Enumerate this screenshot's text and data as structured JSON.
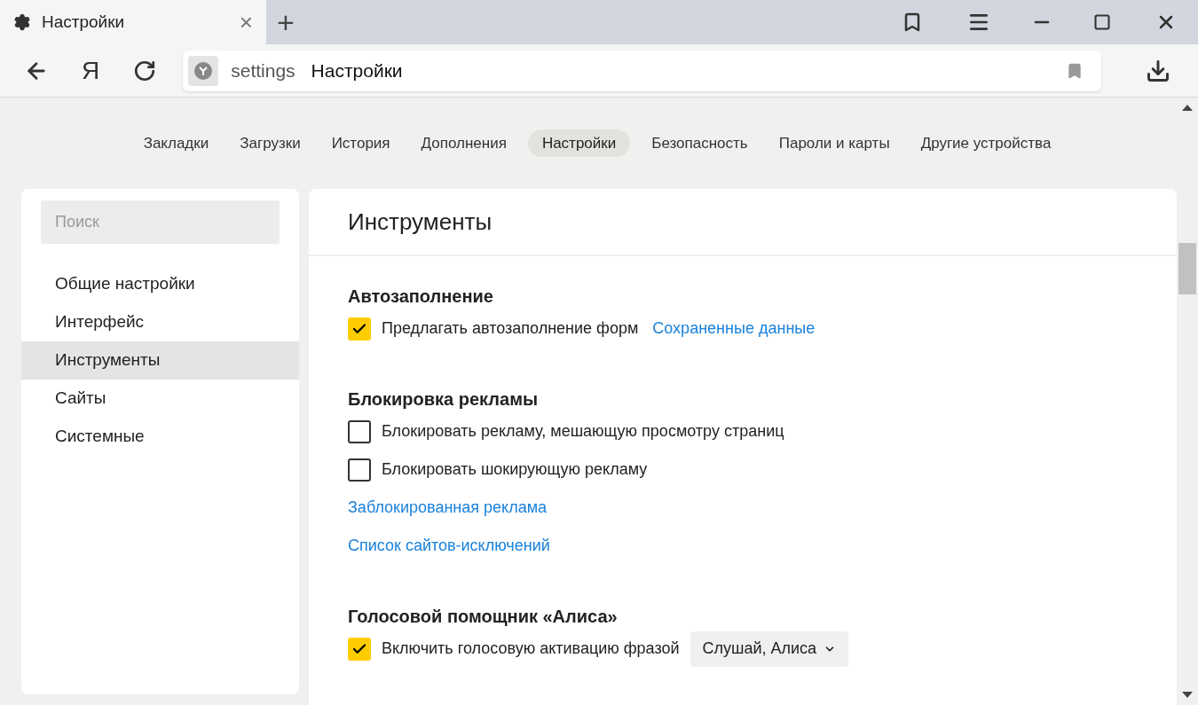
{
  "tab": {
    "title": "Настройки",
    "close": "×"
  },
  "new_tab": "+",
  "toolbar": {
    "logo_letter": "Я",
    "address": {
      "host": "settings",
      "title": "Настройки"
    }
  },
  "nav": [
    {
      "label": "Закладки",
      "selected": false
    },
    {
      "label": "Загрузки",
      "selected": false
    },
    {
      "label": "История",
      "selected": false
    },
    {
      "label": "Дополнения",
      "selected": false
    },
    {
      "label": "Настройки",
      "selected": true
    },
    {
      "label": "Безопасность",
      "selected": false
    },
    {
      "label": "Пароли и карты",
      "selected": false
    },
    {
      "label": "Другие устройства",
      "selected": false
    }
  ],
  "sidebar": {
    "search": {
      "placeholder": "Поиск"
    },
    "items": [
      {
        "label": "Общие настройки",
        "selected": false
      },
      {
        "label": "Интерфейс",
        "selected": false
      },
      {
        "label": "Инструменты",
        "selected": true
      },
      {
        "label": "Сайты",
        "selected": false
      },
      {
        "label": "Системные",
        "selected": false
      }
    ]
  },
  "main": {
    "title": "Инструменты",
    "sections": [
      {
        "heading": "Автозаполнение",
        "items": [
          {
            "kind": "checkbox",
            "label": "Предлагать автозаполнение форм",
            "checked": true,
            "link": "Сохраненные данные"
          }
        ]
      },
      {
        "heading": "Блокировка рекламы",
        "items": [
          {
            "kind": "checkbox",
            "label": "Блокировать рекламу, мешающую просмотру страниц",
            "checked": false
          },
          {
            "kind": "checkbox",
            "label": "Блокировать шокирующую рекламу",
            "checked": false
          },
          {
            "kind": "link",
            "label": "Заблокированная реклама"
          },
          {
            "kind": "link",
            "label": "Список сайтов-исключений"
          }
        ]
      },
      {
        "heading": "Голосовой помощник «Алиса»",
        "items": [
          {
            "kind": "checkbox",
            "label": "Включить голосовую активацию фразой",
            "checked": true,
            "dropdown": "Слушай, Алиса"
          }
        ]
      }
    ]
  }
}
